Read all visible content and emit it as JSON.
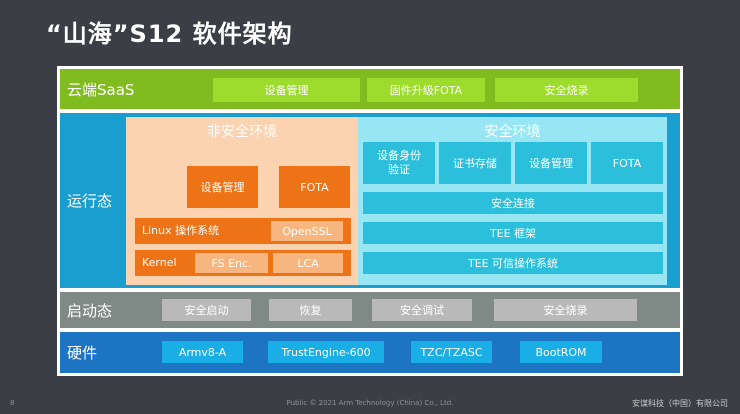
{
  "title": "“山海”S12 软件架构",
  "cloud": {
    "label": "云端SaaS",
    "items": [
      "设备管理",
      "固件升级FOTA",
      "安全烧录"
    ]
  },
  "runtime": {
    "label": "运行态",
    "nonsecure": {
      "title": "非安全环境",
      "device_mgmt": "设备管理",
      "fota": "FOTA",
      "linux": "Linux 操作系统",
      "openssl": "OpenSSL",
      "kernel": "Kernel",
      "fs_enc": "FS Enc.",
      "lca": "LCA"
    },
    "secure": {
      "title": "安全环境",
      "items": [
        "设备身份验证",
        "证书存储",
        "设备管理",
        "FOTA"
      ],
      "rows": [
        "安全连接",
        "TEE 框架",
        "TEE 可信操作系统"
      ]
    }
  },
  "boot": {
    "label": "启动态",
    "items": [
      "安全启动",
      "恢复",
      "安全调试",
      "安全烧录"
    ]
  },
  "hardware": {
    "label": "硬件",
    "items": [
      "Armv8-A",
      "TrustEngine-600",
      "TZC/TZASC",
      "BootROM"
    ]
  },
  "footer": {
    "page": "8",
    "center": "Public © 2021 Arm Technology (China) Co., Ltd.",
    "right": "安谋科技（中国）有限公司"
  }
}
